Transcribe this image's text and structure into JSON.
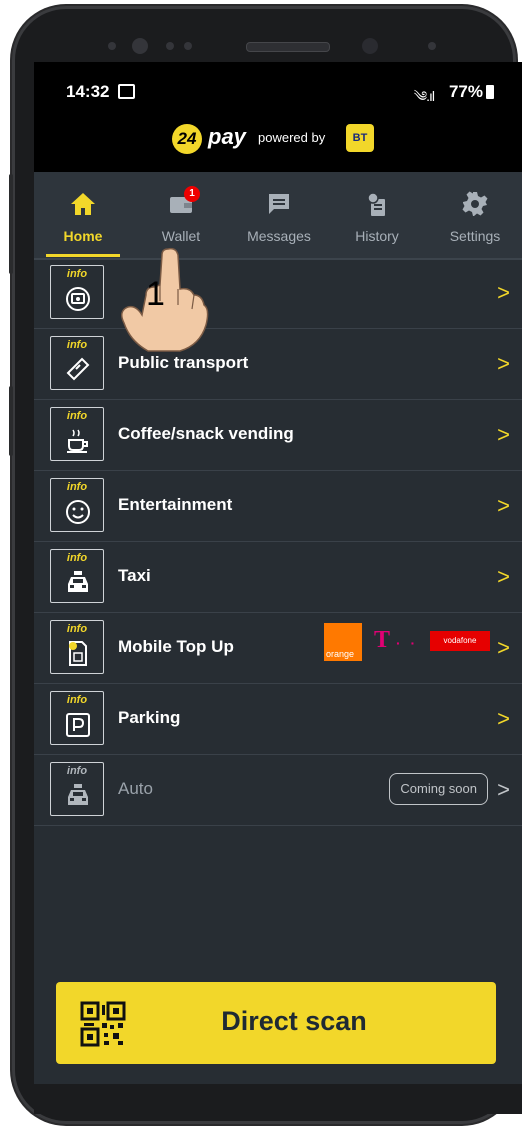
{
  "status": {
    "time": "14:32",
    "battery": "77%",
    "signal": "༄.ıl"
  },
  "brand": {
    "logo_num": "24",
    "logo_word": "pay",
    "powered_by": "powered by",
    "partner": "BT"
  },
  "tabs": [
    {
      "label": "Home",
      "icon": "home-icon",
      "active": true
    },
    {
      "label": "Wallet",
      "icon": "wallet-icon",
      "badge": "1"
    },
    {
      "label": "Messages",
      "icon": "message-icon"
    },
    {
      "label": "History",
      "icon": "history-icon"
    },
    {
      "label": "Settings",
      "icon": "gear-icon"
    }
  ],
  "rows": [
    {
      "label": "",
      "icon": "bill-icon"
    },
    {
      "label": "Public transport",
      "icon": "ticket-icon"
    },
    {
      "label": "Coffee/snack vending",
      "icon": "coffee-icon"
    },
    {
      "label": "Entertainment",
      "icon": "smiley-icon"
    },
    {
      "label": "Taxi",
      "icon": "taxi-icon"
    },
    {
      "label": "Mobile Top Up",
      "icon": "sim-icon"
    },
    {
      "label": "Parking",
      "icon": "parking-icon"
    },
    {
      "label": "Auto",
      "icon": "car-icon",
      "disabled": true
    }
  ],
  "row_info": "info",
  "operators": {
    "orange": "orange",
    "telekom": "T",
    "telekom_dots": "· ·",
    "vodafone": "vodafone"
  },
  "coming_soon": "Coming soon",
  "chevron": ">",
  "scan": {
    "label": "Direct scan"
  },
  "overlay": {
    "step": "1"
  },
  "colors": {
    "accent": "#f2d72a",
    "background": "#272d33",
    "nav": "#2e353c"
  }
}
